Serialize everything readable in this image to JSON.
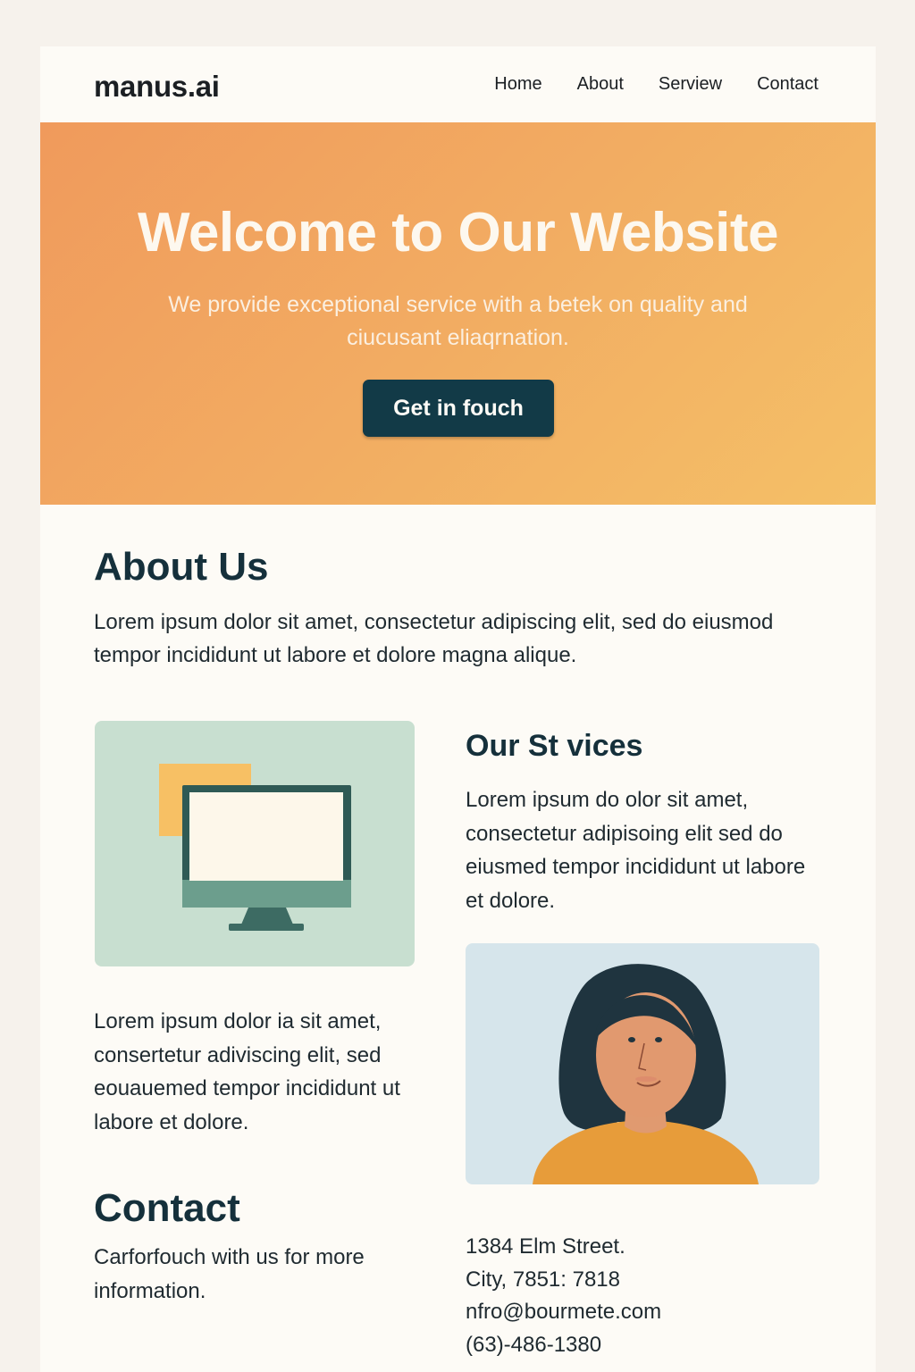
{
  "header": {
    "logo": "manus.ai",
    "nav": [
      "Home",
      "About",
      "Serview",
      "Contact"
    ]
  },
  "hero": {
    "title": "Welcome to Our Website",
    "subtitle": "We provide exceptional service with a betek on quality and ciucusant eliaqrnation.",
    "button_label": "Get in fouch"
  },
  "about": {
    "title": "About Us",
    "body": "Lorem ipsum dolor sit amet, consectetur adipiscing elit, sed do eiusmod tempor incididunt ut labore et dolore magna alique."
  },
  "services": {
    "title": "Our St vices",
    "body": "Lorem ipsum do olor sit amet, consectetur adipisoing elit sed do eiusmed tempor incididunt ut labore et dolore."
  },
  "left_text": "Lorem ipsum dolor ia sit amet, consertetur adiviscing elit, sed eouauemed tempor incididunt ut labore et dolore.",
  "contact": {
    "title": "Contact",
    "body": "Carforfouch with us for more information.",
    "address_lines": [
      "1384 Elm Street.",
      "City, 7851: 7818",
      "nfro@bourmete.com",
      "(63)-486-1380"
    ]
  },
  "colors": {
    "hero_start": "#f09a5c",
    "hero_end": "#f4c067",
    "button": "#123a47",
    "heading": "#15303b",
    "page_bg": "#fdfbf6"
  }
}
